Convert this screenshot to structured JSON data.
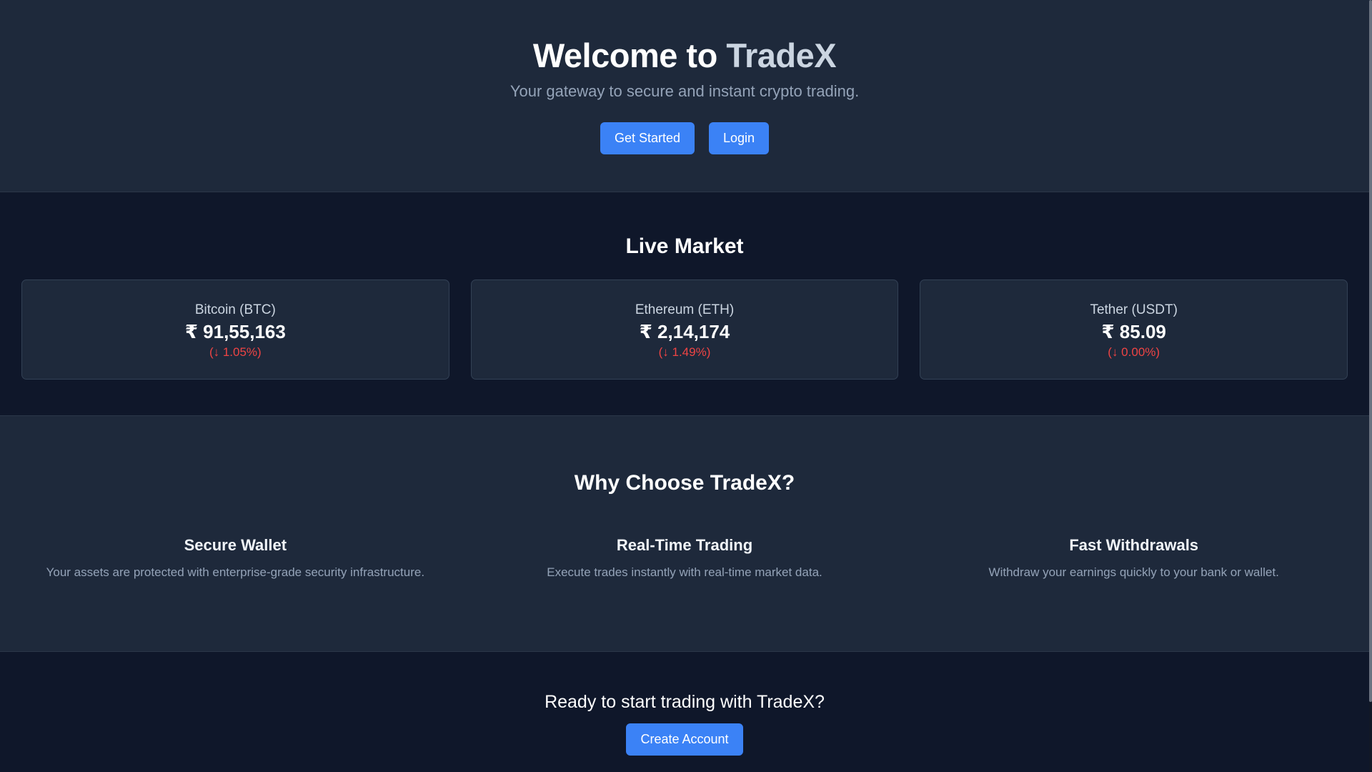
{
  "hero": {
    "title_prefix": "Welcome to ",
    "title_brand": "TradeX",
    "subtitle": "Your gateway to secure and instant crypto trading.",
    "get_started_label": "Get Started",
    "login_label": "Login"
  },
  "market": {
    "title": "Live Market",
    "coins": [
      {
        "name": "Bitcoin (BTC)",
        "price": "₹ 91,55,163",
        "change": "(↓ 1.05%)"
      },
      {
        "name": "Ethereum (ETH)",
        "price": "₹ 2,14,174",
        "change": "(↓ 1.49%)"
      },
      {
        "name": "Tether (USDT)",
        "price": "₹ 85.09",
        "change": "(↓ 0.00%)"
      }
    ]
  },
  "features": {
    "title": "Why Choose TradeX?",
    "items": [
      {
        "title": "Secure Wallet",
        "description": "Your assets are protected with enterprise-grade security infrastructure."
      },
      {
        "title": "Real-Time Trading",
        "description": "Execute trades instantly with real-time market data."
      },
      {
        "title": "Fast Withdrawals",
        "description": "Withdraw your earnings quickly to your bank or wallet."
      }
    ]
  },
  "cta": {
    "title": "Ready to start trading with TradeX?",
    "button_label": "Create Account"
  },
  "colors": {
    "accent": "#3b82f6",
    "negative": "#ef4444",
    "dark_bg": "#0f172a",
    "panel_bg": "#1e293b"
  }
}
